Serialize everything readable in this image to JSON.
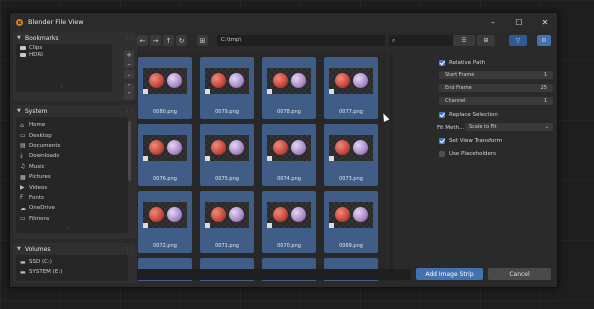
{
  "window": {
    "title": "Blender File View"
  },
  "controls": {
    "minimize": "–",
    "maximize": "☐",
    "close": "✕"
  },
  "sidebar": {
    "bookmarks": {
      "title": "Bookmarks",
      "items": [
        {
          "label": "Clips"
        },
        {
          "label": "HDRI"
        }
      ]
    },
    "system": {
      "title": "System",
      "items": [
        {
          "label": "Home",
          "icon": "⌂"
        },
        {
          "label": "Desktop",
          "icon": "▭"
        },
        {
          "label": "Documents",
          "icon": "▤"
        },
        {
          "label": "Downloads",
          "icon": "⤓"
        },
        {
          "label": "Music",
          "icon": "♫"
        },
        {
          "label": "Pictures",
          "icon": "▦"
        },
        {
          "label": "Videos",
          "icon": "▶"
        },
        {
          "label": "Fonts",
          "icon": "F"
        },
        {
          "label": "OneDrive",
          "icon": "☁"
        },
        {
          "label": "Filmora",
          "icon": "▭"
        }
      ]
    },
    "volumes": {
      "title": "Volumes",
      "items": [
        {
          "label": "SSD (C:)"
        },
        {
          "label": "SYSTEM (E:)"
        }
      ]
    }
  },
  "toolbar": {
    "path": "C:\\tmp\\",
    "search_placeholder": "⌕"
  },
  "files": [
    {
      "name": "0080.png"
    },
    {
      "name": "0079.png"
    },
    {
      "name": "0078.png"
    },
    {
      "name": "0077.png"
    },
    {
      "name": "0076.png"
    },
    {
      "name": "0075.png"
    },
    {
      "name": "0074.png"
    },
    {
      "name": "0073.png"
    },
    {
      "name": "0072.png"
    },
    {
      "name": "0071.png"
    },
    {
      "name": "0070.png"
    },
    {
      "name": "0069.png"
    }
  ],
  "options": {
    "relative_path": {
      "label": "Relative Path",
      "checked": true
    },
    "start_frame": {
      "label": "Start Frame",
      "value": "1"
    },
    "end_frame": {
      "label": "End Frame",
      "value": "25"
    },
    "channel": {
      "label": "Channel",
      "value": "1"
    },
    "replace_selection": {
      "label": "Replace Selection",
      "checked": true
    },
    "fit_method": {
      "label": "Fit Meth...",
      "value": "Scale to Fit"
    },
    "set_view_transform": {
      "label": "Set View Transform",
      "checked": true
    },
    "use_placeholders": {
      "label": "Use Placeholders",
      "checked": false
    }
  },
  "footer": {
    "primary": "Add Image Strip",
    "cancel": "Cancel"
  },
  "colors": {
    "accent": "#4372b0",
    "selected_thumb": "#3f5d86"
  }
}
